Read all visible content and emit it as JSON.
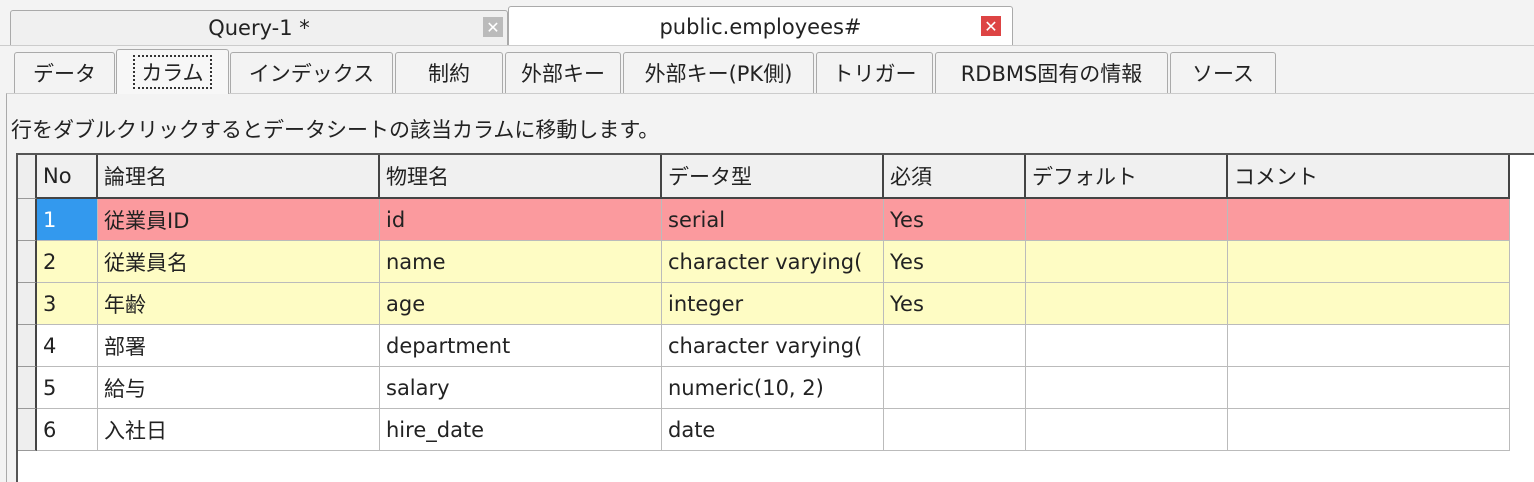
{
  "editor_tabs": [
    {
      "label": "Query-1 *",
      "active": false
    },
    {
      "label": "public.employees#",
      "active": true
    }
  ],
  "sub_tabs": [
    "データ",
    "カラム",
    "インデックス",
    "制約",
    "外部キー",
    "外部キー(PK側)",
    "トリガー",
    "RDBMS固有の情報",
    "ソース"
  ],
  "selected_sub_tab": "カラム",
  "info_text": "行をダブルクリックするとデータシートの該当カラムに移動します。",
  "columns": [
    "No",
    "論理名",
    "物理名",
    "データ型",
    "必須",
    "デフォルト",
    "コメント"
  ],
  "rows": [
    [
      "1",
      "従業員ID",
      "id",
      "serial",
      "Yes",
      "",
      ""
    ],
    [
      "2",
      "従業員名",
      "name",
      "character varying(",
      "Yes",
      "",
      ""
    ],
    [
      "3",
      "年齢",
      "age",
      "integer",
      "Yes",
      "",
      ""
    ],
    [
      "4",
      "部署",
      "department",
      "character varying(",
      "",
      "",
      ""
    ],
    [
      "5",
      "給与",
      "salary",
      "numeric(10, 2)",
      "",
      "",
      ""
    ],
    [
      "6",
      "入社日",
      "hire_date",
      "date",
      "",
      "",
      ""
    ]
  ],
  "colors": {
    "primary_key_row": "#fb9a9e",
    "required_row": "#fefcc4",
    "selected_cell": "#3399ee"
  }
}
